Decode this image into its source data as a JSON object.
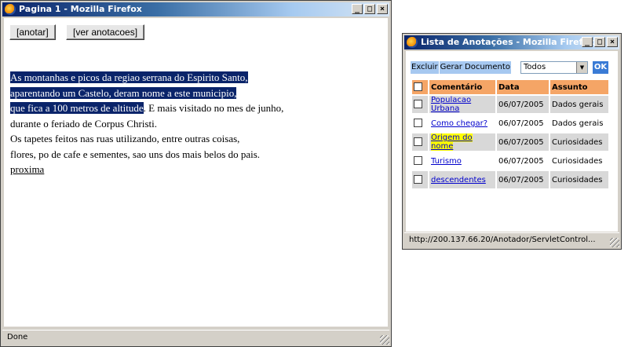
{
  "main_window": {
    "title": "Pagina 1 - Mozilla Firefox",
    "buttons": {
      "anotar": "[anotar]",
      "ver": "[ver anotacoes]"
    },
    "paragraph": {
      "hl1": "As montanhas e picos da regiao serrana do Espirito Santo,",
      "hl2": "aparentando um Castelo, deram nome a este municipio,",
      "hl3": "que fica a 100 metros de altitude",
      "rest3": ". E mais visitado no mes de junho,",
      "line4": "durante o feriado de Corpus Christi.",
      "line5": "Os tapetes feitos nas ruas utilizando, entre outras coisas,",
      "line6": "flores, po de cafe e sementes, sao uns dos mais belos do pais.",
      "link": "proxima"
    },
    "status": "Done"
  },
  "ann_window": {
    "title": "Lista de Anotações - Mozilla Firefox",
    "toolbar": {
      "excluir": "Excluir",
      "gerar": "Gerar Documento",
      "filter_value": "Todos",
      "ok": "OK"
    },
    "columns": [
      "Comentário",
      "Data",
      "Assunto"
    ],
    "rows": [
      {
        "comment": "Populacao Urbana",
        "date": "06/07/2005",
        "subject": "Dados gerais"
      },
      {
        "comment": "Como chegar?",
        "date": "06/07/2005",
        "subject": "Dados gerais"
      },
      {
        "comment": "Origem do nome",
        "date": "06/07/2005",
        "subject": "Curiosidades"
      },
      {
        "comment": "Turismo",
        "date": "06/07/2005",
        "subject": "Curiosidades"
      },
      {
        "comment": "descendentes",
        "date": "06/07/2005",
        "subject": "Curiosidades"
      }
    ],
    "status": "http://200.137.66.20/Anotador/ServletControl..."
  },
  "icons": {
    "minimize": "minimize-icon",
    "maximize": "maximize-icon",
    "close": "close-icon",
    "app": "firefox-icon"
  },
  "colors": {
    "title_bar": "#0a246a",
    "selection": "#0a246a",
    "table_header": "#f5a566",
    "highlight_row_link": "#ffff00",
    "ok_button": "#3a7bd5"
  }
}
